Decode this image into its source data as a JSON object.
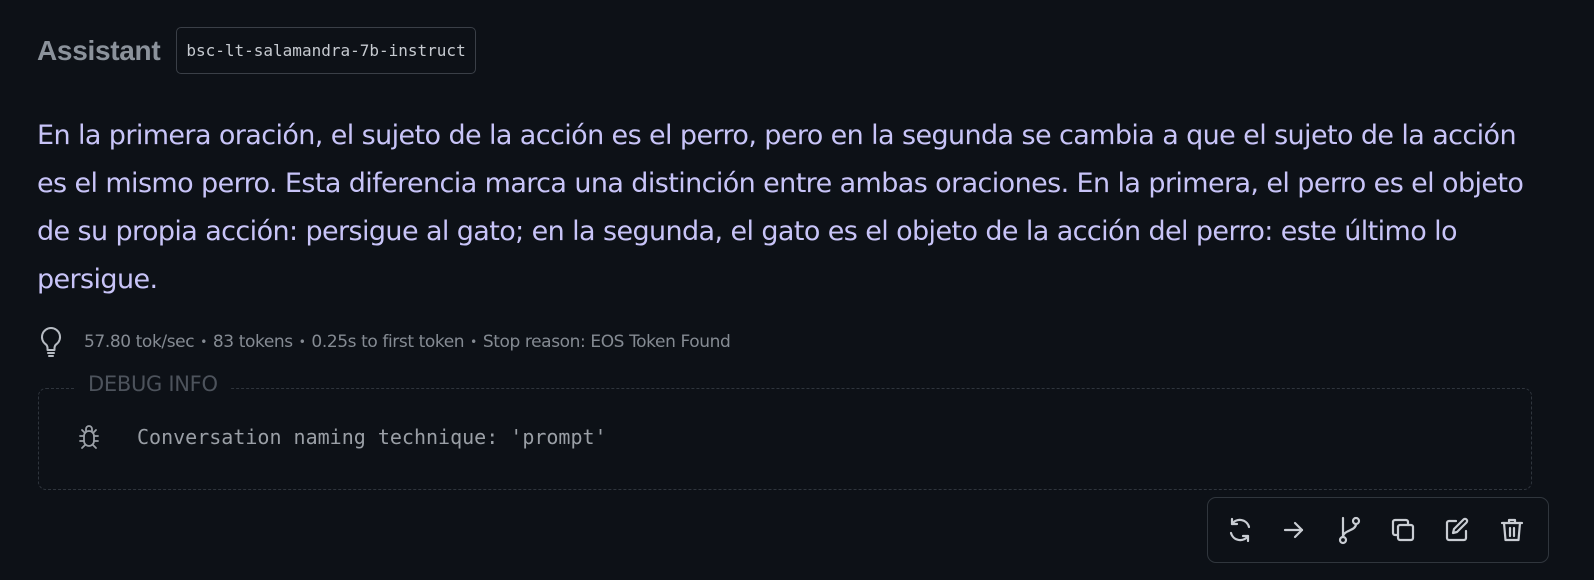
{
  "header": {
    "role": "Assistant",
    "model": "bsc-lt-salamandra-7b-instruct"
  },
  "message": {
    "text": "En la primera oración, el sujeto de la acción es el perro, pero en la segunda se cambia a que el sujeto de la acción es el mismo perro. Esta diferencia marca una distinción entre ambas oraciones. En la primera, el perro es el objeto de su propia acción: persigue al gato; en la segunda, el gato es el objeto de la acción del perro: este último lo persigue."
  },
  "stats": {
    "icon": "lightbulb-icon",
    "speed": "57.80 tok/sec",
    "tokens": "83 tokens",
    "first_token": "0.25s to first token",
    "stop_reason": "Stop reason: EOS Token Found",
    "separator": "•"
  },
  "debug": {
    "title": "DEBUG INFO",
    "icon": "bug-icon",
    "text": "Conversation naming technique: 'prompt'"
  },
  "toolbar": {
    "icons": [
      "regenerate-icon",
      "continue-icon",
      "branch-icon",
      "copy-icon",
      "edit-icon",
      "delete-icon"
    ]
  },
  "colors": {
    "background": "#0d1117",
    "message_text": "#c8c4f8",
    "muted_text": "#858b93",
    "border": "#30363d"
  }
}
